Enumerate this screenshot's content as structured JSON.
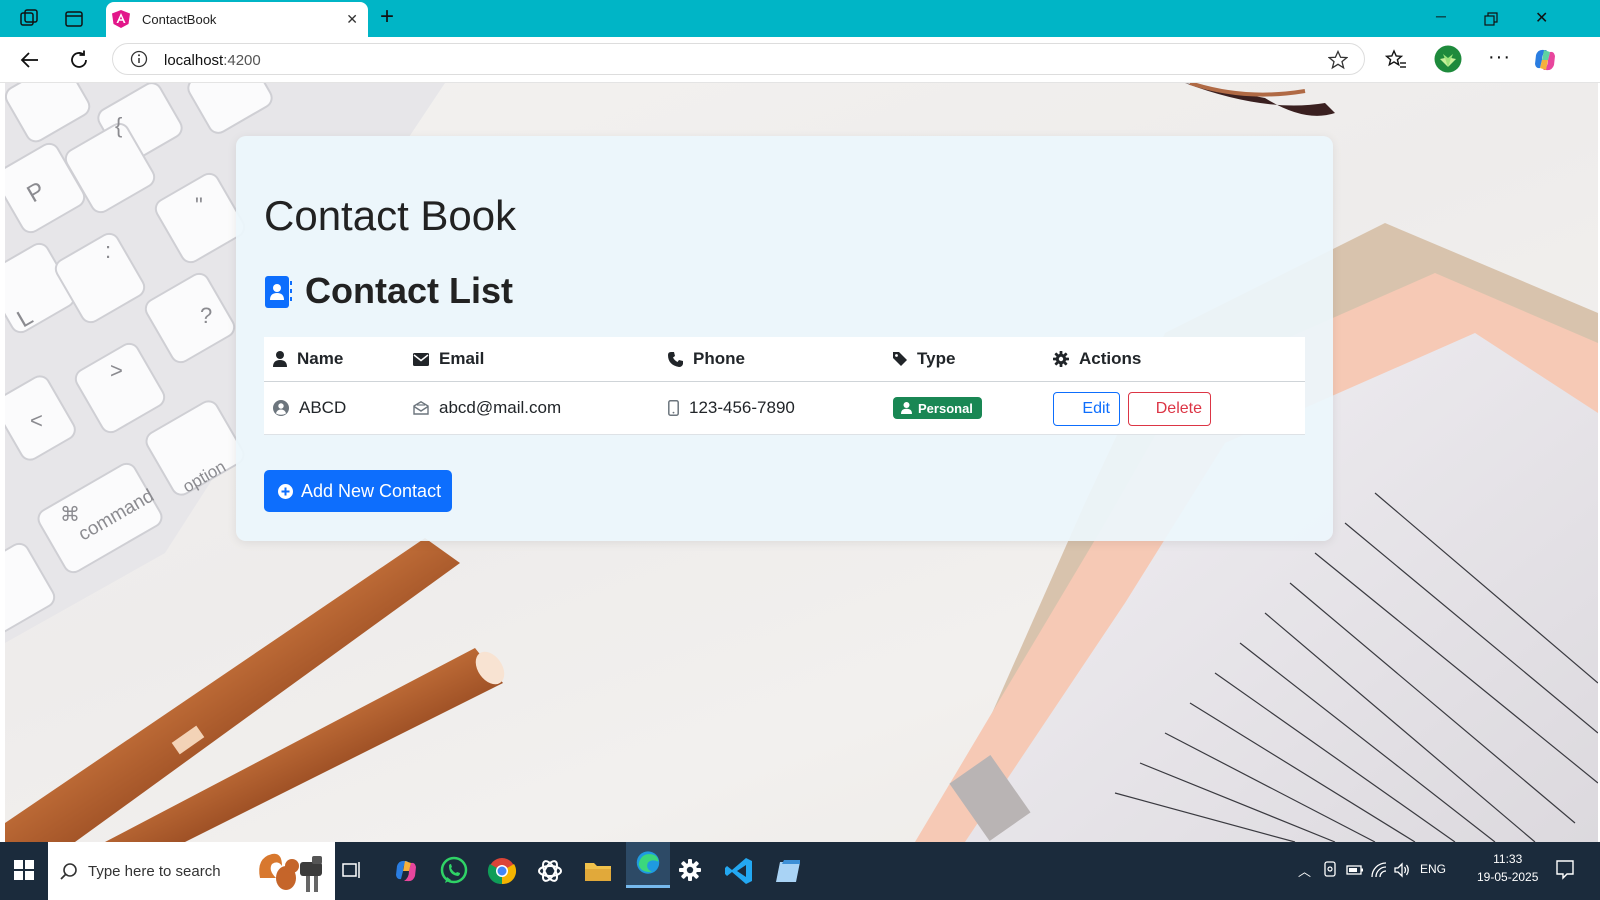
{
  "browser": {
    "tab_title": "ContactBook",
    "address_host": "localhost",
    "address_port": ":4200"
  },
  "app": {
    "title": "Contact Book",
    "list_title": "Contact List",
    "columns": {
      "name": "Name",
      "email": "Email",
      "phone": "Phone",
      "type": "Type",
      "actions": "Actions"
    },
    "contacts": [
      {
        "name": "ABCD",
        "email": "abcd@mail.com",
        "phone": "123-456-7890",
        "type": "Personal"
      }
    ],
    "edit_label": "Edit",
    "delete_label": "Delete",
    "add_label": "Add New Contact",
    "colors": {
      "primary": "#0d6efd",
      "danger": "#dc3545",
      "success": "#198754"
    }
  },
  "background_keys": [
    "P",
    "L",
    "command",
    "option"
  ],
  "taskbar": {
    "search_placeholder": "Type here to search",
    "language": "ENG",
    "time": "11:33",
    "date": "19-05-2025"
  }
}
